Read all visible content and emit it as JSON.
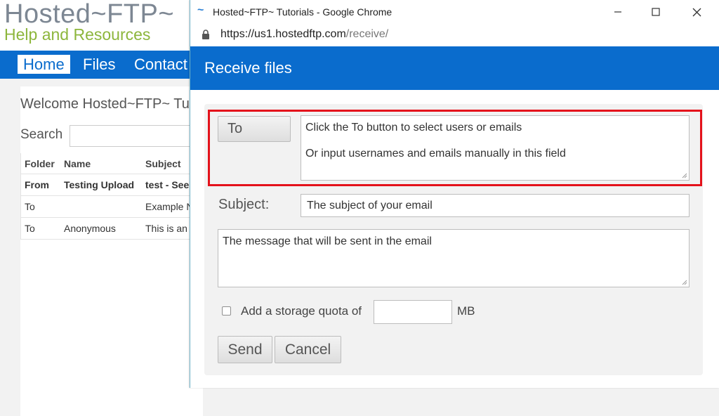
{
  "background_page": {
    "logo": {
      "line1": "Hosted~FTP~",
      "line2": "Help and Resources"
    },
    "nav": {
      "items": [
        "Home",
        "Files",
        "Contact"
      ],
      "active": "Home"
    },
    "welcome": "Welcome Hosted~FTP~ Tu",
    "search_label": "Search",
    "table": {
      "headers": [
        "Folder",
        "Name",
        "Subject"
      ],
      "rows": [
        {
          "folder": "From",
          "name": "Testing Upload",
          "subject": "test - See",
          "bold": true
        },
        {
          "folder": "To",
          "name": "",
          "subject": "Example N",
          "bold": false
        },
        {
          "folder": "To",
          "name": "Anonymous",
          "subject": "This is an",
          "bold": false
        }
      ]
    }
  },
  "popup": {
    "window_title": "Hosted~FTP~ Tutorials - Google Chrome",
    "url": {
      "base": "https://us1.hostedftp.com",
      "path": "/receive/"
    },
    "header_title": "Receive files",
    "form": {
      "to_button": "To",
      "to_field_line1": "Click the To button to select users or emails",
      "to_field_line2": "Or input usernames and emails manually in this field",
      "subject_label": "Subject:",
      "subject_placeholder": "The subject of your email",
      "message_placeholder": "The message that will be sent in the email",
      "quota_label": "Add a storage quota of",
      "quota_unit": "MB",
      "send_button": "Send",
      "cancel_button": "Cancel"
    }
  },
  "colors": {
    "brand_blue": "#0a6ccd",
    "logo_gray": "#7d8793",
    "logo_green": "#8db63c",
    "highlight_red": "#e4121b"
  },
  "icons": {
    "title_icon": "hosted-ftp-favicon",
    "lock": "lock-icon",
    "minimize": "minimize-icon",
    "maximize": "maximize-icon",
    "close": "close-icon"
  }
}
